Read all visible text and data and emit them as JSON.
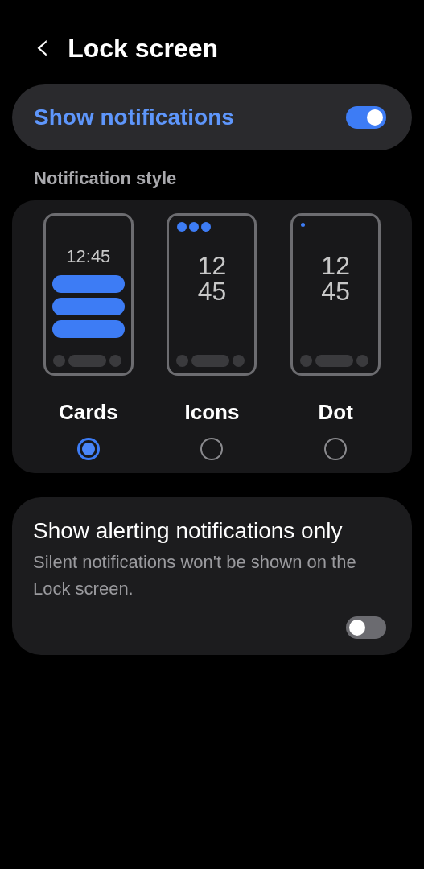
{
  "header": {
    "back_glyph": "‹",
    "title": "Lock screen"
  },
  "show_notifications": {
    "label": "Show notifications",
    "on": true
  },
  "notification_style": {
    "heading": "Notification style",
    "styles": [
      {
        "kind": "cards",
        "label": "Cards",
        "clock_lines": [
          "12:45"
        ],
        "selected": true
      },
      {
        "kind": "icons",
        "label": "Icons",
        "clock_lines": [
          "12",
          "45"
        ],
        "selected": false
      },
      {
        "kind": "dot",
        "label": "Dot",
        "clock_lines": [
          "12",
          "45"
        ],
        "selected": false
      }
    ]
  },
  "alerting_only": {
    "title": "Show alerting notifications only",
    "description": "Silent notifications won't be shown on the Lock screen.",
    "on": false
  }
}
